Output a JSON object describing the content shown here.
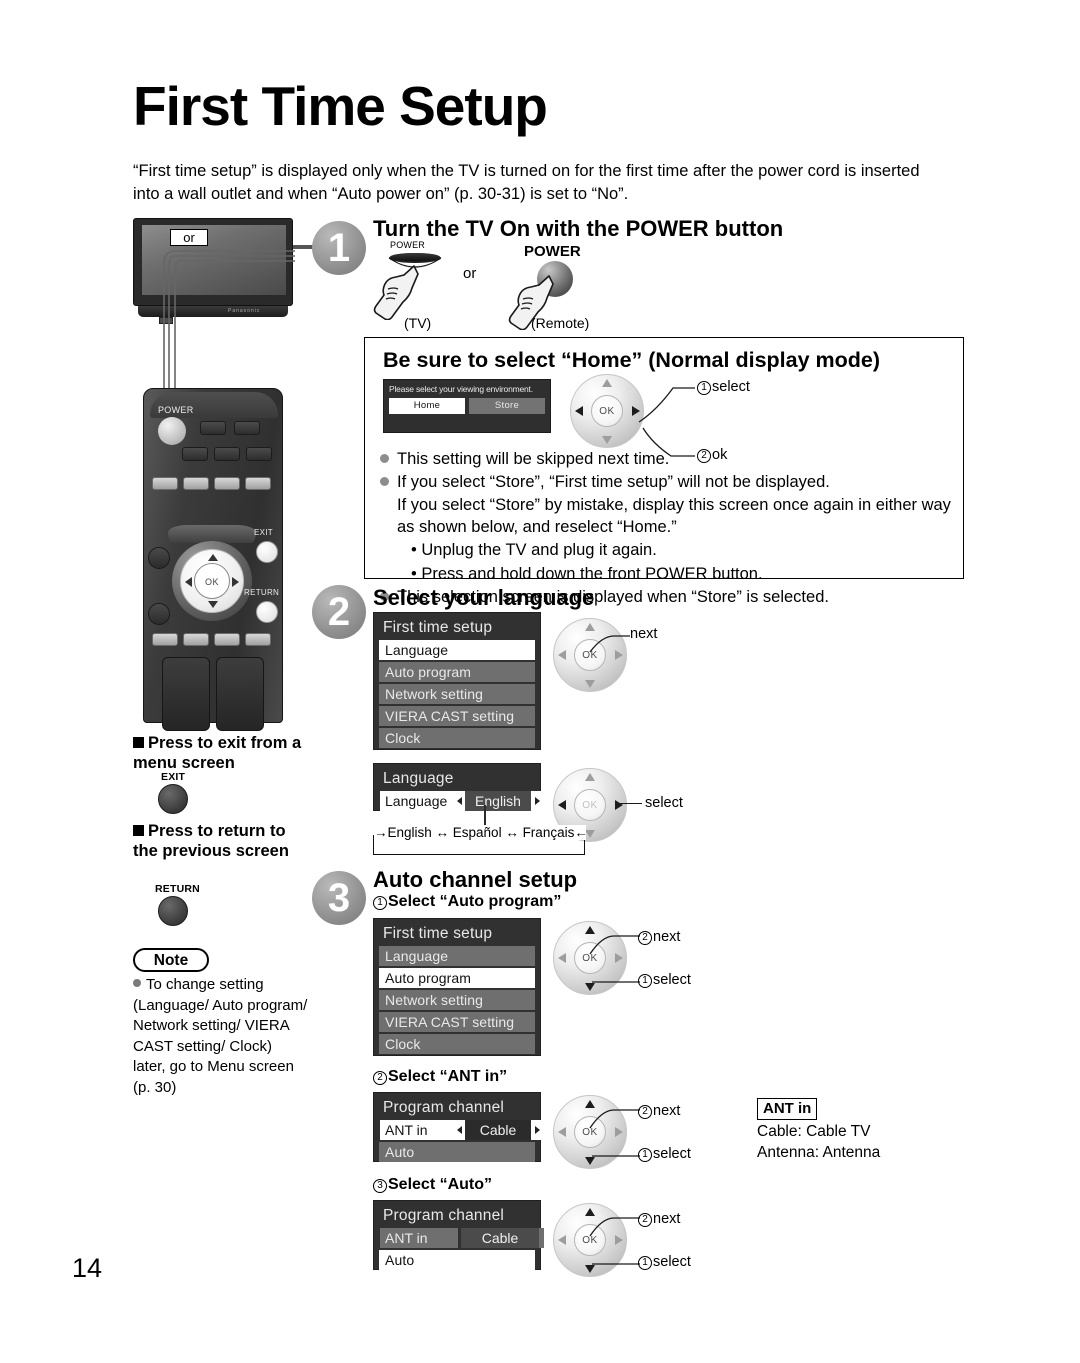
{
  "page": {
    "title": "First Time Setup",
    "intro": "“First time setup” is displayed only when the TV is turned on for the first time after the power cord is inserted into a wall outlet and when “Auto power on” (p. 30-31) is set to “No”.",
    "page_number": "14"
  },
  "illustration": {
    "or_badge": "or",
    "tv_brand": "Panasonic",
    "remote_power_label": "POWER",
    "remote_ok_label": "OK",
    "remote_exit_label": "EXIT",
    "remote_return_label": "RETURN"
  },
  "left_column": {
    "exit_block": {
      "heading": "Press to exit from a menu screen",
      "key_label": "EXIT"
    },
    "return_block": {
      "heading": "Press to return to the previous screen",
      "key_label": "RETURN"
    },
    "note": {
      "pill": "Note",
      "text": "To change setting (Language/ Auto program/ Network setting/ VIERA CAST setting/ Clock) later, go to Menu screen (p. 30)"
    }
  },
  "step1": {
    "number": "1",
    "heading": "Turn the TV On with the POWER button",
    "tv_power_label": "POWER",
    "remote_power_label": "POWER",
    "or_label": "or",
    "tv_caption": "(TV)",
    "remote_caption": "(Remote)",
    "home_box": {
      "heading": "Be sure to select “Home” (Normal display mode)",
      "osd": {
        "prompt": "Please select your viewing environment.",
        "option_home": "Home",
        "option_store": "Store"
      },
      "callouts": {
        "select": "select",
        "ok": "ok",
        "select_num": "1",
        "ok_num": "2"
      },
      "bullets": [
        "This setting will be skipped next time.",
        "If you select “Store”, “First time setup” will not be displayed.",
        "This selection screen is displayed when “Store” is selected."
      ],
      "sub_text": "If you select “Store” by mistake, display this screen once again in either way as shown below, and reselect “Home.”",
      "sub_bullets": [
        "• Unplug the TV and plug it again.",
        "• Press and hold down the front POWER button."
      ]
    }
  },
  "step2": {
    "number": "2",
    "heading": "Select your language",
    "menu": {
      "title": "First time setup",
      "items": [
        {
          "label": "Language",
          "selected": true
        },
        {
          "label": "Auto program",
          "selected": false
        },
        {
          "label": "Network setting",
          "selected": false
        },
        {
          "label": "VIERA CAST setting",
          "selected": false
        },
        {
          "label": "Clock",
          "selected": false
        }
      ]
    },
    "callout_next": "next",
    "language_panel": {
      "title": "Language",
      "row_label": "Language",
      "row_value": "English"
    },
    "callout_select": "select",
    "cycle": "English ↔ Español ↔ Français"
  },
  "step3": {
    "number": "3",
    "heading": "Auto channel setup",
    "sub1": {
      "num": "1",
      "heading": "Select “Auto program”",
      "menu": {
        "title": "First time setup",
        "items": [
          {
            "label": "Language",
            "selected": false
          },
          {
            "label": "Auto program",
            "selected": true
          },
          {
            "label": "Network setting",
            "selected": false
          },
          {
            "label": "VIERA CAST setting",
            "selected": false
          },
          {
            "label": "Clock",
            "selected": false
          }
        ]
      },
      "callout_next": "next",
      "callout_next_num": "2",
      "callout_select": "select",
      "callout_select_num": "1"
    },
    "sub2": {
      "num": "2",
      "heading": "Select “ANT in”",
      "menu": {
        "title": "Program channel",
        "row_label": "ANT in",
        "row_value": "Cable",
        "item_auto": "Auto"
      },
      "callout_next": "next",
      "callout_next_num": "2",
      "callout_select": "select",
      "callout_select_num": "1"
    },
    "sub3": {
      "num": "3",
      "heading": "Select “Auto”",
      "menu": {
        "title": "Program channel",
        "row_label": "ANT in",
        "row_value": "Cable",
        "item_auto": "Auto"
      },
      "callout_next": "next",
      "callout_next_num": "2",
      "callout_select": "select",
      "callout_select_num": "1"
    },
    "ant_note": {
      "header": "ANT in",
      "line1": "Cable:  Cable TV",
      "line2": "Antenna:  Antenna"
    }
  }
}
